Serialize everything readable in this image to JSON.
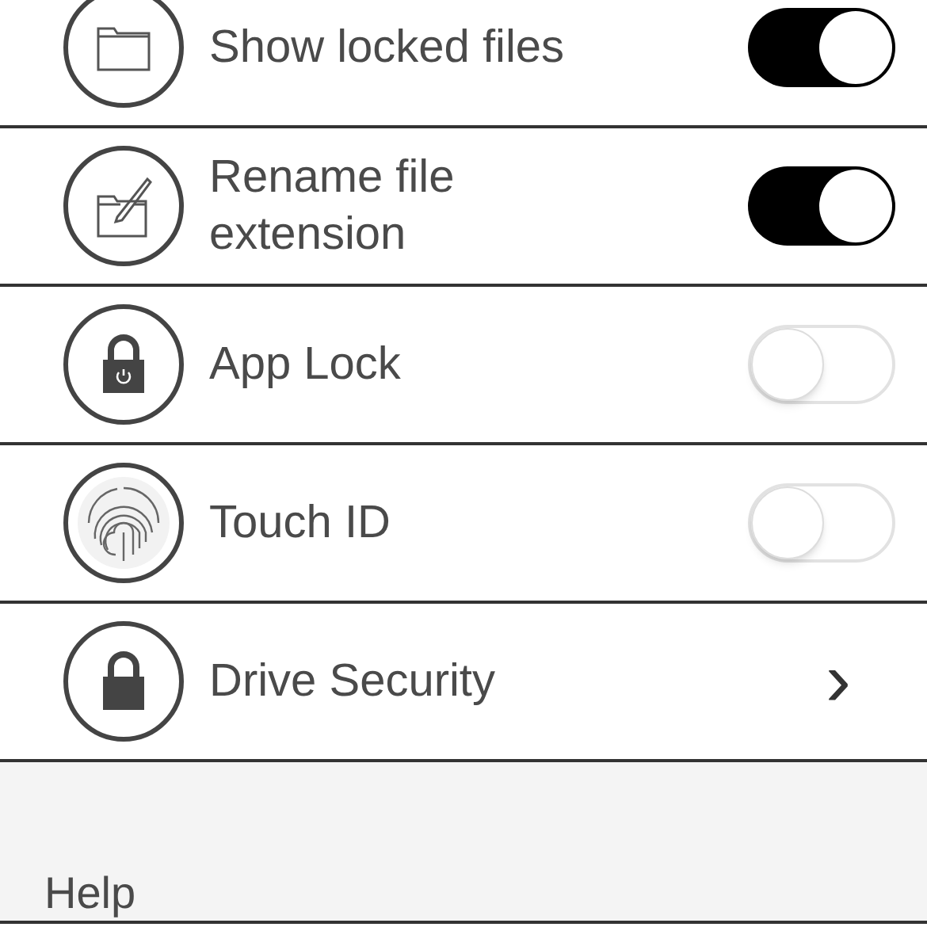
{
  "settings": [
    {
      "label": "Show locked files",
      "kind": "toggle",
      "on": true
    },
    {
      "label": "Rename file extension",
      "kind": "toggle",
      "on": true
    },
    {
      "label": "App Lock",
      "kind": "toggle",
      "on": false
    },
    {
      "label": "Touch ID",
      "kind": "toggle",
      "on": false
    },
    {
      "label": "Drive Security",
      "kind": "disclosure",
      "chevron": "›"
    }
  ],
  "section_header": "Help"
}
